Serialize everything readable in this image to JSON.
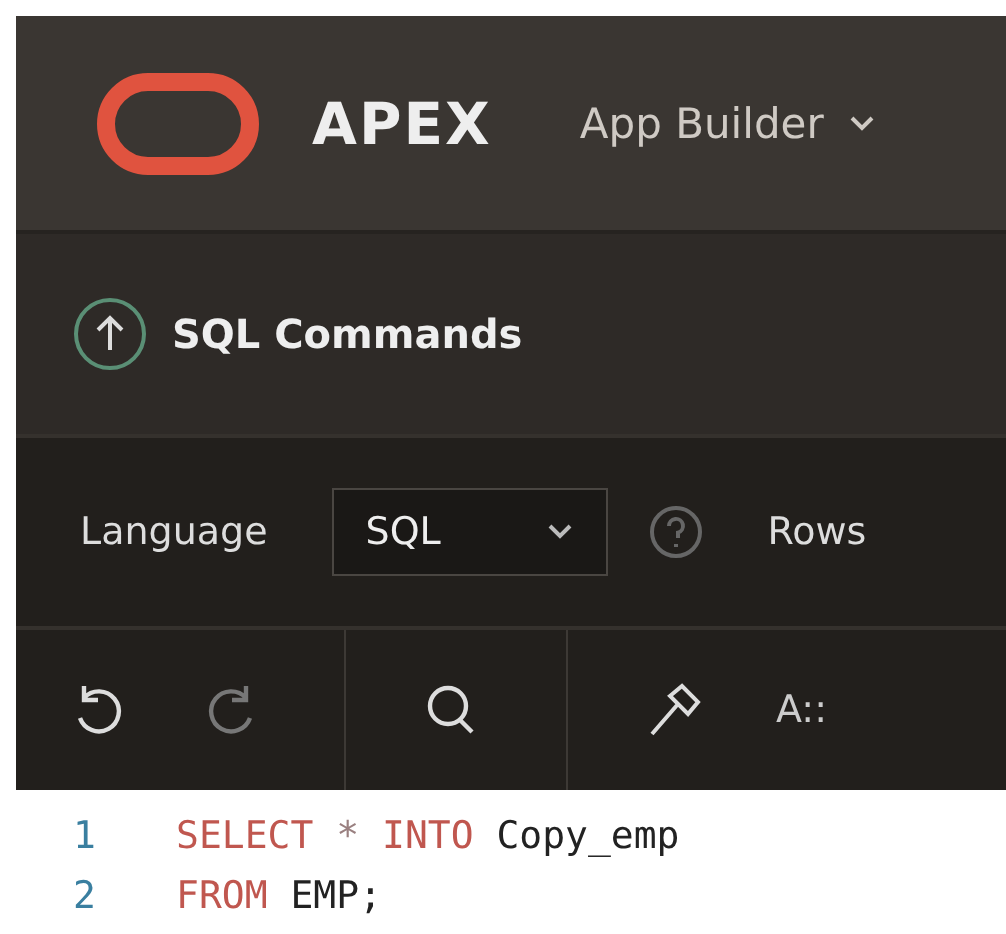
{
  "header": {
    "product": "APEX",
    "menu": "App Builder"
  },
  "breadcrumb": {
    "title": "SQL Commands"
  },
  "toolbar": {
    "language_label": "Language",
    "language_value": "SQL",
    "rows_label": "Rows"
  },
  "editor_tools": {
    "format_label": "A::"
  },
  "editor": {
    "lines": [
      {
        "number": "1",
        "tokens": [
          {
            "text": "SELECT",
            "kind": "keyword"
          },
          {
            "text": "*",
            "kind": "operator"
          },
          {
            "text": "INTO",
            "kind": "keyword"
          },
          {
            "text": "Copy_emp",
            "kind": "plain"
          }
        ]
      },
      {
        "number": "2",
        "tokens": [
          {
            "text": "FROM",
            "kind": "keyword"
          },
          {
            "text": "EMP;",
            "kind": "plain"
          }
        ]
      }
    ]
  }
}
